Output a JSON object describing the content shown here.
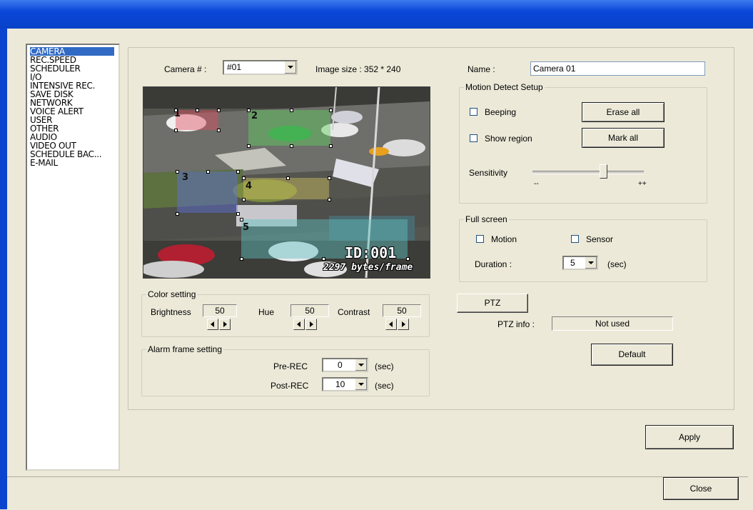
{
  "sidebar": {
    "items": [
      {
        "label": "CAMERA",
        "selected": true
      },
      {
        "label": "REC.SPEED"
      },
      {
        "label": "SCHEDULER"
      },
      {
        "label": "I/O"
      },
      {
        "label": "INTENSIVE REC."
      },
      {
        "label": "SAVE DISK"
      },
      {
        "label": "NETWORK"
      },
      {
        "label": "VOICE ALERT"
      },
      {
        "label": "USER"
      },
      {
        "label": "OTHER"
      },
      {
        "label": "AUDIO"
      },
      {
        "label": "VIDEO OUT"
      },
      {
        "label": "SCHEDULE BAC..."
      },
      {
        "label": "E-MAIL"
      }
    ]
  },
  "camera": {
    "label": "Camera # :",
    "value": "#01",
    "image_size": "Image size : 352 * 240",
    "name_label": "Name :",
    "name_value": "Camera 01"
  },
  "video": {
    "zones": [
      "1",
      "2",
      "3",
      "4",
      "5"
    ],
    "osd_id": "ID:001",
    "osd_bytes": "2297 bytes/frame"
  },
  "color_setting": {
    "title": "Color setting",
    "brightness_label": "Brightness",
    "brightness": "50",
    "hue_label": "Hue",
    "hue": "50",
    "contrast_label": "Contrast",
    "contrast": "50"
  },
  "alarm": {
    "title": "Alarm frame setting",
    "pre_label": "Pre-REC",
    "pre_value": "0",
    "post_label": "Post-REC",
    "post_value": "10",
    "unit": "(sec)"
  },
  "motion": {
    "title": "Motion Detect Setup",
    "beeping": "Beeping",
    "show_region": "Show region",
    "erase_all": "Erase all",
    "mark_all": "Mark all",
    "sensitivity": "Sensitivity",
    "min": "--",
    "max": "++",
    "sensitivity_level": 0.65
  },
  "fullscreen": {
    "title": "Full screen",
    "motion": "Motion",
    "sensor": "Sensor",
    "duration_label": "Duration  :",
    "duration_value": "5",
    "unit": "(sec)"
  },
  "ptz": {
    "button": "PTZ",
    "info_label": "PTZ info :",
    "info_value": "Not used"
  },
  "buttons": {
    "default": "Default",
    "apply": "Apply",
    "close": "Close"
  }
}
